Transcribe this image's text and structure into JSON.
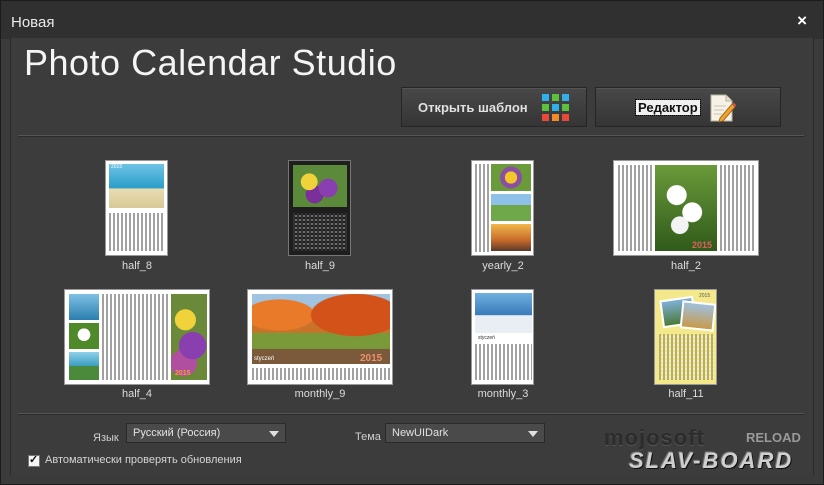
{
  "window": {
    "title": "Новая",
    "close_symbol": "×"
  },
  "app_title": "Photo Calendar Studio",
  "buttons": {
    "open_template": "Открыть шаблон",
    "editor": "Редактор"
  },
  "templates": [
    {
      "name": "half_8"
    },
    {
      "name": "half_9"
    },
    {
      "name": "yearly_2"
    },
    {
      "name": "half_2"
    },
    {
      "name": "half_4"
    },
    {
      "name": "monthly_9"
    },
    {
      "name": "monthly_3"
    },
    {
      "name": "half_11"
    }
  ],
  "thumb_text": {
    "t1_year": "2015",
    "t4_year": "2015",
    "t5_year": "2015",
    "t6_month": "styczeń",
    "t6_year": "2015",
    "t7_month": "styczeń",
    "t8_year": "2015"
  },
  "settings": {
    "language_label": "Язык",
    "language_value": "Русский (Россия)",
    "theme_label": "Тема",
    "theme_value": "NewUIDark",
    "auto_update_label": "Автоматически проверять обновления"
  },
  "watermark": {
    "line1": "mojosoft",
    "line1b": "RELOAD",
    "line2": "SLAV-BOARD"
  },
  "colors": {
    "background": "#3c3c3c",
    "titlebar": "#303030",
    "text": "#f4f4f4"
  }
}
